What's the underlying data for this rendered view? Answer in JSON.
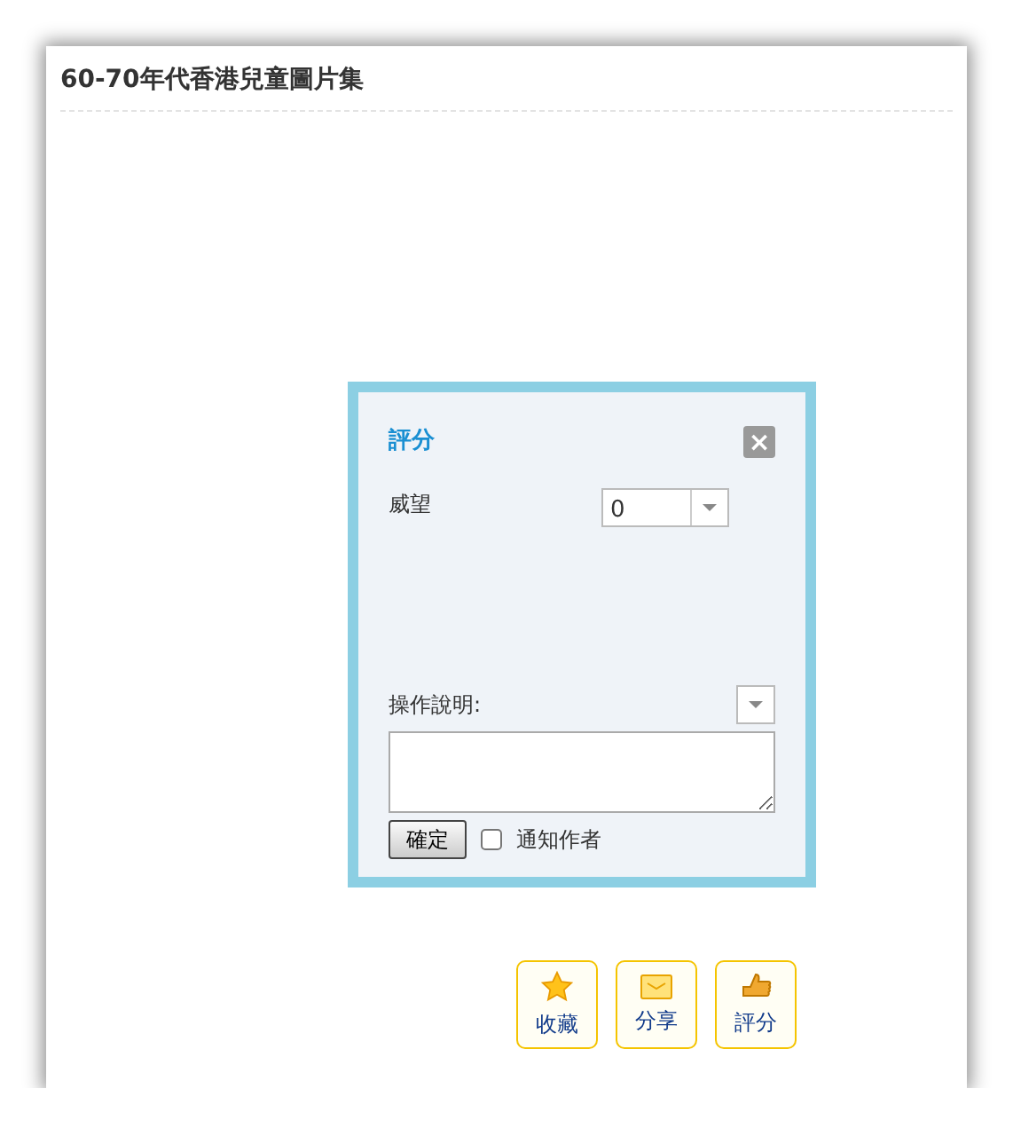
{
  "page": {
    "title": "60-70年代香港兒童圖片集"
  },
  "dialog": {
    "title": "評分",
    "close": "×",
    "fields": [
      {
        "label": "威望",
        "value": "0"
      }
    ],
    "note_label": "操作說明:",
    "submit": "確定",
    "notify": {
      "label": "通知作者",
      "checked": false
    }
  },
  "actions": [
    {
      "kind": "star",
      "label": "收藏"
    },
    {
      "kind": "mail",
      "label": "分享"
    },
    {
      "kind": "thumb",
      "label": "評分"
    }
  ]
}
